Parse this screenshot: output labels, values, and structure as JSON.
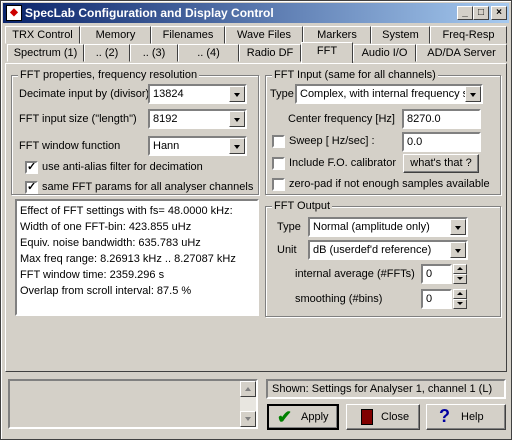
{
  "window": {
    "title": "SpecLab  Configuration and Display Control"
  },
  "tabs_row1": [
    "TRX Control",
    "Memory",
    "Filenames",
    "Wave Files",
    "Markers",
    "System",
    "Freq-Resp"
  ],
  "tabs_row2": [
    "Spectrum (1)",
    ".. (2)",
    ".. (3)",
    ".. (4)",
    "Radio DF",
    "FFT",
    "Audio I/O",
    "AD/DA Server"
  ],
  "active_tab": "FFT",
  "fft_properties": {
    "legend": "FFT properties, frequency resolution",
    "decimate_label": "Decimate input by (divisor)",
    "decimate_value": "13824",
    "input_size_label": "FFT input size (\"length\")",
    "input_size_value": "8192",
    "window_label": "FFT window function",
    "window_value": "Hann",
    "antialias_label": "use anti-alias filter for decimation",
    "antialias_checked": true,
    "same_params_label": "same FFT params for all analyser channels",
    "same_params_checked": true
  },
  "fft_info": [
    "Effect of FFT settings with fs= 48.0000 kHz:",
    "Width of one FFT-bin: 423.855 uHz",
    "Equiv. noise bandwidth: 635.783 uHz",
    "Max freq range: 8.26913 kHz .. 8.27087 kHz",
    "FFT window time: 2359.296 s",
    "Overlap from scroll interval: 87.5 %"
  ],
  "fft_input": {
    "legend": "FFT Input (same for all channels)",
    "type_label": "Type",
    "type_value": "Complex, with internal frequency s",
    "center_freq_label": "Center frequency [Hz]",
    "center_freq_value": "8270.0",
    "sweep_label": "Sweep [ Hz/sec] :",
    "sweep_value": "0.0",
    "sweep_checked": false,
    "calibrator_label": "Include F.O. calibrator",
    "calibrator_checked": false,
    "whats_that_label": "what's that ?",
    "zeropad_label": "zero-pad if not enough samples available",
    "zeropad_checked": false
  },
  "fft_output": {
    "legend": "FFT Output",
    "type_label": "Type",
    "type_value": "Normal (amplitude only)",
    "unit_label": "Unit",
    "unit_value": "dB (userdef'd reference)",
    "avg_label": "internal average (#FFTs)",
    "avg_value": "0",
    "smooth_label": "smoothing (#bins)",
    "smooth_value": "0"
  },
  "status": {
    "shown_text": "Shown: Settings for Analyser 1, channel 1 (L)"
  },
  "buttons": {
    "apply": "Apply",
    "close": "Close",
    "help": "Help"
  },
  "colors": {
    "titlebar_start": "#0a246a",
    "titlebar_end": "#a6caf0",
    "face": "#d4d0c8",
    "apply_check": "#008000"
  }
}
